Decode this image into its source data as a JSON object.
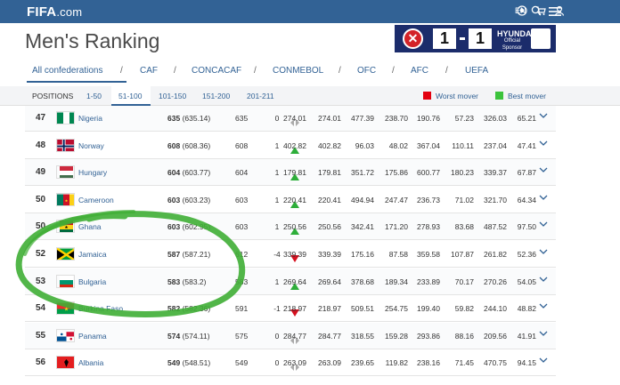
{
  "header": {
    "logo_main": "FIFA",
    "logo_suffix": ".com",
    "lang": "EN"
  },
  "page": {
    "title": "Men's Ranking"
  },
  "banner": {
    "score_home": "1",
    "score_away": "1",
    "sponsor": "HYUNDAI",
    "sponsor_sub": "Official Sponsor",
    "colors": {
      "bg": "#1b2c6b",
      "accent": "#d32328"
    }
  },
  "confederations": [
    "All confederations",
    "CAF",
    "CONCACAF",
    "CONMEBOL",
    "OFC",
    "AFC",
    "UEFA"
  ],
  "positions": {
    "label": "POSITIONS",
    "ranges": [
      "1-50",
      "51-100",
      "101-150",
      "151-200",
      "201-211"
    ],
    "active": "51-100"
  },
  "legend": {
    "worst_label": "Worst mover",
    "best_label": "Best mover",
    "worst_color": "#e3000f",
    "best_color": "#3cc33c"
  },
  "rows": [
    {
      "rank": "47",
      "team": "Nigeria",
      "pts": "635",
      "pts_exact": "(635.14)",
      "prev": "635",
      "move": "0",
      "trend": "same",
      "c1": "274.01",
      "c2": "274.01",
      "c3": "477.39",
      "c4": "238.70",
      "c5": "190.76",
      "c6": "57.23",
      "c7": "326.03",
      "c8": "65.21",
      "flag": "nigeria"
    },
    {
      "rank": "48",
      "team": "Norway",
      "pts": "608",
      "pts_exact": "(608.36)",
      "prev": "608",
      "move": "1",
      "trend": "up",
      "c1": "402.82",
      "c2": "402.82",
      "c3": "96.03",
      "c4": "48.02",
      "c5": "367.04",
      "c6": "110.11",
      "c7": "237.04",
      "c8": "47.41",
      "flag": "norway"
    },
    {
      "rank": "49",
      "team": "Hungary",
      "pts": "604",
      "pts_exact": "(603.77)",
      "prev": "604",
      "move": "1",
      "trend": "up",
      "c1": "179.81",
      "c2": "179.81",
      "c3": "351.72",
      "c4": "175.86",
      "c5": "600.77",
      "c6": "180.23",
      "c7": "339.37",
      "c8": "67.87",
      "flag": "hungary"
    },
    {
      "rank": "50",
      "team": "Cameroon",
      "pts": "603",
      "pts_exact": "(603.23)",
      "prev": "603",
      "move": "1",
      "trend": "up",
      "c1": "220.41",
      "c2": "220.41",
      "c3": "494.94",
      "c4": "247.47",
      "c5": "236.73",
      "c6": "71.02",
      "c7": "321.70",
      "c8": "64.34",
      "flag": "cameroon"
    },
    {
      "rank": "50",
      "team": "Ghana",
      "pts": "603",
      "pts_exact": "(602.95)",
      "prev": "603",
      "move": "1",
      "trend": "up",
      "c1": "250.56",
      "c2": "250.56",
      "c3": "342.41",
      "c4": "171.20",
      "c5": "278.93",
      "c6": "83.68",
      "c7": "487.52",
      "c8": "97.50",
      "flag": "ghana"
    },
    {
      "rank": "52",
      "team": "Jamaica",
      "pts": "587",
      "pts_exact": "(587.21)",
      "prev": "612",
      "move": "-4",
      "trend": "down",
      "c1": "339.39",
      "c2": "339.39",
      "c3": "175.16",
      "c4": "87.58",
      "c5": "359.58",
      "c6": "107.87",
      "c7": "261.82",
      "c8": "52.36",
      "flag": "jamaica"
    },
    {
      "rank": "53",
      "team": "Bulgaria",
      "pts": "583",
      "pts_exact": "(583.2)",
      "prev": "583",
      "move": "1",
      "trend": "up",
      "c1": "269.64",
      "c2": "269.64",
      "c3": "378.68",
      "c4": "189.34",
      "c5": "233.89",
      "c6": "70.17",
      "c7": "270.26",
      "c8": "54.05",
      "flag": "bulgaria"
    },
    {
      "rank": "54",
      "team": "Burkina Faso",
      "pts": "582",
      "pts_exact": "(582.36)",
      "prev": "591",
      "move": "-1",
      "trend": "down",
      "c1": "218.97",
      "c2": "218.97",
      "c3": "509.51",
      "c4": "254.75",
      "c5": "199.40",
      "c6": "59.82",
      "c7": "244.10",
      "c8": "48.82",
      "flag": "burkina"
    },
    {
      "rank": "55",
      "team": "Panama",
      "pts": "574",
      "pts_exact": "(574.11)",
      "prev": "575",
      "move": "0",
      "trend": "same",
      "c1": "284.77",
      "c2": "284.77",
      "c3": "318.55",
      "c4": "159.28",
      "c5": "293.86",
      "c6": "88.16",
      "c7": "209.56",
      "c8": "41.91",
      "flag": "panama"
    },
    {
      "rank": "56",
      "team": "Albania",
      "pts": "549",
      "pts_exact": "(548.51)",
      "prev": "549",
      "move": "0",
      "trend": "same",
      "c1": "263.09",
      "c2": "263.09",
      "c3": "239.65",
      "c4": "119.82",
      "c5": "238.16",
      "c6": "71.45",
      "c7": "470.75",
      "c8": "94.15",
      "flag": "albania"
    }
  ]
}
